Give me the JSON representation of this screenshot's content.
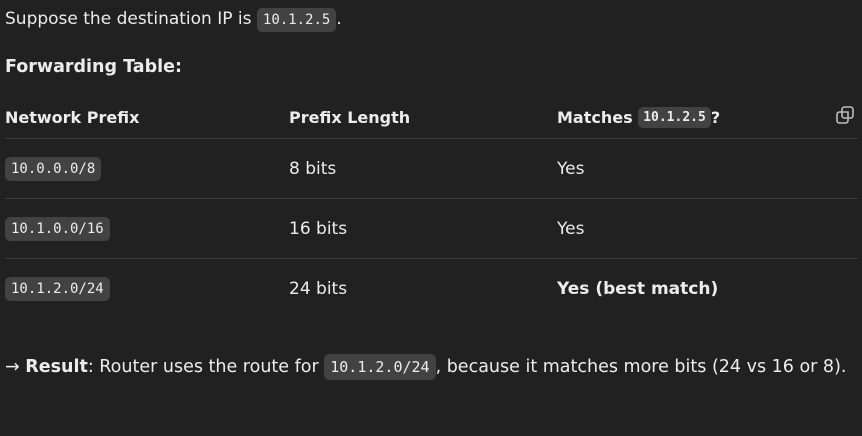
{
  "intro": {
    "text_before": "Suppose the destination IP is ",
    "ip": "10.1.2.5",
    "text_after": "."
  },
  "heading": "Forwarding Table:",
  "table": {
    "headers": {
      "prefix": "Network Prefix",
      "length": "Prefix Length",
      "matches_before": "Matches ",
      "matches_ip": "10.1.2.5",
      "matches_after": "?"
    },
    "rows": [
      {
        "prefix": "10.0.0.0/8",
        "length": "8 bits",
        "matches": "Yes"
      },
      {
        "prefix": "10.1.0.0/16",
        "length": "16 bits",
        "matches": "Yes"
      },
      {
        "prefix": "10.1.2.0/24",
        "length": "24 bits",
        "matches": "Yes (best match)"
      }
    ],
    "copy_icon": "copy-icon"
  },
  "result": {
    "arrow": "→",
    "label": "Result",
    "text_before": ": Router uses the route for ",
    "route": "10.1.2.0/24",
    "text_after": ", because it matches more bits (24 vs 16 or 8)."
  }
}
